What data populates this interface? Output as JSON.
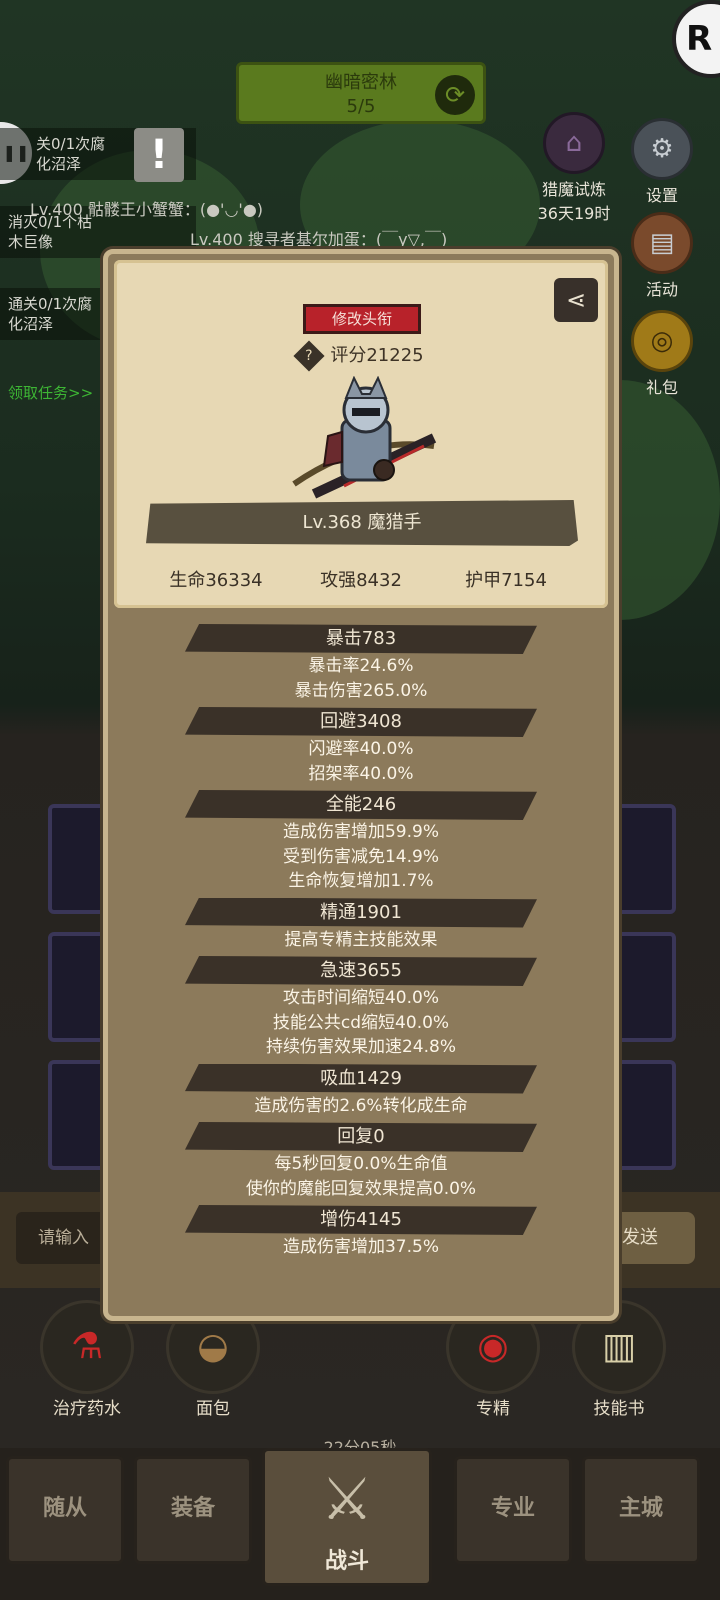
{
  "stage": {
    "name": "幽暗密林",
    "progress": "5/5"
  },
  "quests": [
    {
      "text": "关0/1次腐\n化沼泽"
    },
    {
      "text": "消灭0/1个枯\n木巨像"
    },
    {
      "text": "通关0/1次腐\n化沼泽"
    }
  ],
  "quest_link": "领取任务>>",
  "chat_lines": [
    "Lv.400 骷髅王小蟹蟹：(●'◡'●)",
    "Lv.400 搜寻者基尔加蛋：(￣y▽,￣)"
  ],
  "side": {
    "event_title": "猎魔试炼",
    "event_time": "36天19时",
    "settings": "设置",
    "activity": "活动",
    "gift": "礼包"
  },
  "top_right_badge": "R",
  "chat": {
    "placeholder": "请输入",
    "send": "发送"
  },
  "items": [
    {
      "label": "治疗药水",
      "icon": "potion-icon"
    },
    {
      "label": "面包",
      "icon": "bread-icon"
    },
    {
      "label": "专精",
      "icon": "spec-icon"
    },
    {
      "label": "技能书",
      "icon": "skillbook-icon"
    }
  ],
  "timer": "22分05秒",
  "nav": {
    "follower": "随从",
    "equipment": "装备",
    "battle": "战斗",
    "profession": "专业",
    "city": "主城"
  },
  "modal": {
    "edit_title": "修改头衔",
    "score": "评分21225",
    "name": "Lv.368 魔猎手",
    "hp": "生命36334",
    "atk": "攻强8432",
    "armor": "护甲7154",
    "attributes": [
      {
        "header": "暴击783",
        "lines": [
          "暴击率24.6%",
          "暴击伤害265.0%"
        ]
      },
      {
        "header": "回避3408",
        "lines": [
          "闪避率40.0%",
          "招架率40.0%"
        ]
      },
      {
        "header": "全能246",
        "lines": [
          "造成伤害增加59.9%",
          "受到伤害减免14.9%",
          "生命恢复增加1.7%"
        ]
      },
      {
        "header": "精通1901",
        "lines": [
          "提高专精主技能效果"
        ]
      },
      {
        "header": "急速3655",
        "lines": [
          "攻击时间缩短40.0%",
          "技能公共cd缩短40.0%",
          "持续伤害效果加速24.8%"
        ]
      },
      {
        "header": "吸血1429",
        "lines": [
          "造成伤害的2.6%转化成生命"
        ]
      },
      {
        "header": "回复0",
        "lines": [
          "每5秒回复0.0%生命值",
          "使你的魔能回复效果提高0.0%"
        ]
      },
      {
        "header": "增伤4145",
        "lines": [
          "造成伤害增加37.5%"
        ]
      }
    ]
  }
}
